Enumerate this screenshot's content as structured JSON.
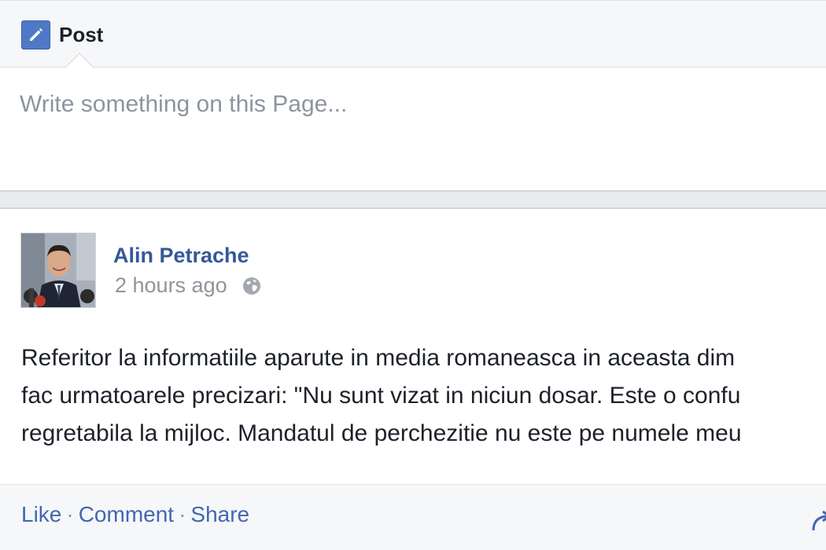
{
  "composer": {
    "tab_label": "Post",
    "tab_icon": "pencil-icon",
    "placeholder": "Write something on this Page..."
  },
  "story": {
    "author": "Alin Petrache",
    "timestamp": "2 hours ago",
    "privacy_icon": "globe-icon",
    "text_lines": [
      "Referitor la informatiile aparute in media romaneasca in aceasta dim",
      "fac urmatoarele precizari: \"Nu sunt vizat in niciun dosar. Este o confu",
      "regretabila la mijloc. Mandatul de perchezitie nu este pe numele meu"
    ],
    "actions": {
      "like": "Like",
      "comment": "Comment",
      "share": "Share",
      "separator": "·"
    }
  },
  "colors": {
    "link_blue": "#365899",
    "action_blue": "#4267b2",
    "muted_gray": "#90949c",
    "header_bg": "#f6f7f9",
    "separator_bg": "#e9ebee"
  }
}
